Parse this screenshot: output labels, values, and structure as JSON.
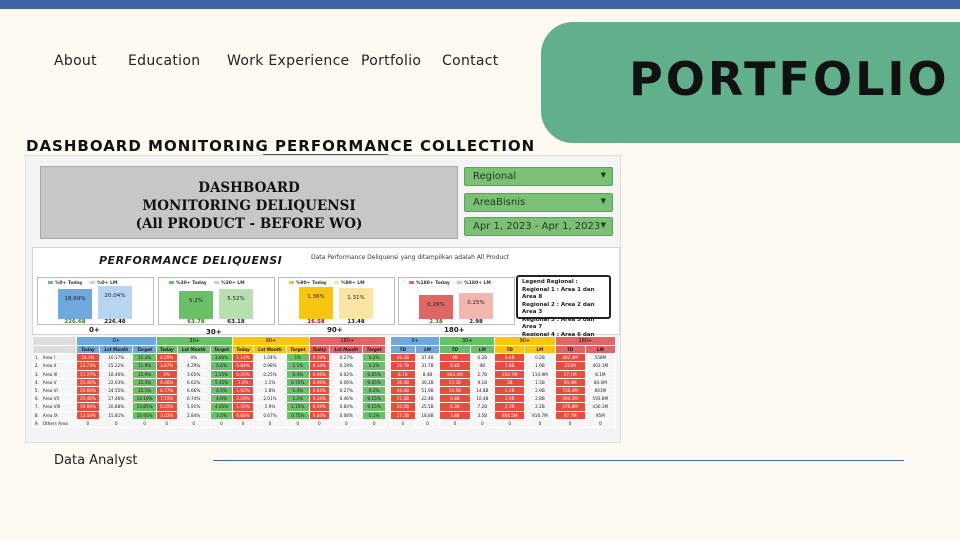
{
  "nav": {
    "about": "About",
    "education": "Education",
    "work_experience": "Work Experience",
    "portfolio": "Portfolio",
    "contact": "Contact"
  },
  "banner_title": "PORTFOLIO",
  "section_title": "DASHBOARD MONITORING PERFORMANCE COLLECTION",
  "caption": "Data Analyst",
  "colors": {
    "topbar": "#3f65a4",
    "banner": "#62af8b",
    "filter": "#7cc077"
  },
  "dashboard": {
    "header": [
      "DASHBOARD",
      "MONITORING DELIQUENSI",
      "(All PRODUCT - BEFORE WO)"
    ],
    "filters": [
      "Regional",
      "AreaBisnis",
      "Apr 1, 2023 - Apr 1, 2023"
    ],
    "perf_title": "PERFORMANCE DELIQUENSI",
    "perf_desc": "Data Performance Deliquensi yang ditampilkan adalah All Product",
    "cards": [
      {
        "group": "0+",
        "leg_a": "%0+ Today",
        "leg_b": "%0+ LM",
        "today_pct": "18.69%",
        "lm_pct": "20.04%",
        "today_val": "226.68",
        "lm_val": "226.48"
      },
      {
        "group": "30+",
        "leg_a": "%30+ Today",
        "leg_b": "%30+ LM",
        "today_pct": "5.2%",
        "lm_pct": "5.52%",
        "today_val": "63.78",
        "lm_val": "63.18"
      },
      {
        "group": "90+",
        "leg_a": "%90+ Today",
        "leg_b": "%90+ LM",
        "today_pct": "1.36%",
        "lm_pct": "1.31%",
        "today_val": "16.58",
        "lm_val": "13.48"
      },
      {
        "group": "180+",
        "leg_a": "%180+ Today",
        "leg_b": "%180+ LM",
        "today_pct": "0.29%",
        "lm_pct": "0.25%",
        "today_val": "2.38",
        "lm_val": "2.98"
      }
    ],
    "legend": [
      "Legend Regional :",
      "Regional 1 : Area 1 dan Area 8",
      "Regional 2 : Area 2 dan Area 3",
      "Regional 3 : Area 5 dan Area 7",
      "Regional 4 : Area 6 dan Area 9"
    ],
    "left_table": {
      "groups": [
        "0+",
        "30+",
        "90+",
        "180+"
      ],
      "sub": [
        "Today",
        "Lst Month",
        "Target",
        "Today",
        "Lst Month",
        "Target",
        "Today",
        "Lst Month",
        "Target",
        "Today",
        "Lst Month",
        "Target"
      ],
      "rows": [
        [
          "1.",
          "Area I",
          "19.3%",
          "16.17%",
          "15.3%",
          "4.29%",
          "4%",
          "3.66%",
          "1.14%",
          "1.04%",
          "1%",
          "0.19%",
          "0.27%",
          "0.2%"
        ],
        [
          "2.",
          "Area II",
          "13.73%",
          "15.22%",
          "11.9%",
          "3.87%",
          "4.29%",
          "5.6%",
          "0.84%",
          "0.98%",
          "1.1%",
          "0.14%",
          "0.19%",
          "0.2%"
        ],
        [
          "3.",
          "Area III",
          "17.27%",
          "18.46%",
          "15.9%",
          "2%",
          "3.65%",
          "1.55%",
          "0.45%",
          "0.25%",
          "0.4%",
          "0.06%",
          "0.02%",
          "0.05%"
        ],
        [
          "4.",
          "Area V",
          "21.46%",
          "22.03%",
          "15.4%",
          "6.46%",
          "6.62%",
          "5.45%",
          "1.4%",
          "1.1%",
          "0.75%",
          "0.06%",
          "0.06%",
          "0.05%"
        ],
        [
          "5.",
          "Area VI",
          "20.69%",
          "24.55%",
          "15.1%",
          "6.77%",
          "6.66%",
          "4.5%",
          "1.92%",
          "1.8%",
          "1.4%",
          "0.84%",
          "0.27%",
          "0.2%"
        ],
        [
          "6.",
          "Area VII",
          "25.46%",
          "27.46%",
          "14.19%",
          "7.15%",
          "6.74%",
          "4.9%",
          "2.29%",
          "2.01%",
          "1.2%",
          "0.34%",
          "0.46%",
          "0.15%"
        ],
        [
          "7.",
          "Area VIII",
          "19.89%",
          "20.88%",
          "13.85%",
          "6.01%",
          "5.91%",
          "4.05%",
          "1.59%",
          "1.9%",
          "1.15%",
          "0.29%",
          "0.84%",
          "0.15%"
        ],
        [
          "8.",
          "Area IX",
          "13.54%",
          "15.81%",
          "10.95%",
          "3.02%",
          "2.84%",
          "3.5%",
          "0.68%",
          "0.67%",
          "0.75%",
          "0.04%",
          "0.08%",
          "0.1%"
        ],
        [
          "9.",
          "Others Area",
          "0",
          "0",
          "0",
          "0",
          "0",
          "0",
          "0",
          "0",
          "0",
          "0",
          "0",
          "0"
        ]
      ]
    },
    "right_table": {
      "groups": [
        "0+",
        "30+",
        "90+",
        "180+"
      ],
      "sub": [
        "TD",
        "LM",
        "TD",
        "LM",
        "TD",
        "LM",
        "TD",
        "LM"
      ],
      "rows": [
        [
          "49.2B",
          "37.4B",
          "9B",
          "6.2B",
          "0.4B",
          "0.2B",
          "402.4M",
          "558M"
        ],
        [
          "29.7B",
          "31.7B",
          "8.4B",
          "9B",
          "1.8B",
          "1.9B",
          "311M",
          "403.1M"
        ],
        [
          "8.1B",
          "8.4B",
          "944.4M",
          "2.7B",
          "204.7M",
          "114.9M",
          "27.1M",
          "8.1M"
        ],
        [
          "39.4B",
          "30.2B",
          "13.3B",
          "9.1B",
          "3B",
          "1.5B",
          "90.4M",
          "84.4M"
        ],
        [
          "44.4B",
          "51.9B",
          "14.5B",
          "14.8B",
          "4.2B",
          "2.9B",
          "730.4M",
          "801M"
        ],
        [
          "21.5B",
          "22.4B",
          "6.8B",
          "10.4B",
          "2.0B",
          "2.8B",
          "294.2M",
          "593.8M"
        ],
        [
          "24.5B",
          "25.5B",
          "6.3B",
          "7.2B",
          "2.3B",
          "2.2B",
          "270.8M",
          "430.1M"
        ],
        [
          "17.2B",
          "18.8B",
          "3.8B",
          "3.5B",
          "864.5M",
          "816.7M",
          "47.7M",
          "95M"
        ],
        [
          "0",
          "0",
          "0",
          "0",
          "0",
          "0",
          "0",
          "0"
        ]
      ]
    }
  }
}
